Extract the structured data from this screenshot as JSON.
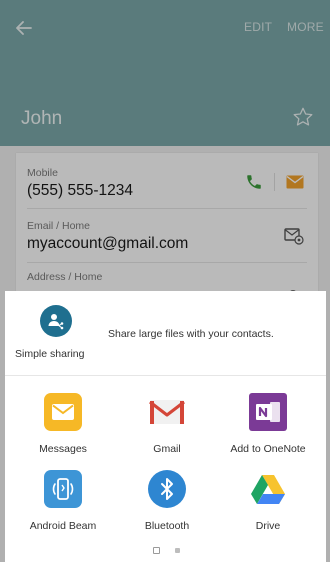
{
  "header": {
    "name": "John",
    "edit_label": "EDIT",
    "more_label": "MORE"
  },
  "contact": {
    "mobile": {
      "label": "Mobile",
      "value": "(555) 555-1234"
    },
    "email": {
      "label": "Email / Home",
      "value": "myaccount@gmail.com"
    },
    "address": {
      "label": "Address / Home"
    }
  },
  "share_sheet": {
    "simple_sharing": {
      "label": "Simple sharing",
      "description": "Share large files with your contacts."
    },
    "apps": [
      {
        "label": "Messages",
        "icon": "messages-icon"
      },
      {
        "label": "Gmail",
        "icon": "gmail-icon"
      },
      {
        "label": "Add to OneNote",
        "icon": "onenote-icon"
      },
      {
        "label": "Android Beam",
        "icon": "android-beam-icon"
      },
      {
        "label": "Bluetooth",
        "icon": "bluetooth-icon"
      },
      {
        "label": "Drive",
        "icon": "drive-icon"
      }
    ],
    "page_indicator": {
      "current": 1,
      "total": 2
    }
  },
  "colors": {
    "header": "#7aa6a8",
    "call_green": "#3c9a3c",
    "message_orange": "#f0a12c",
    "simple_sharing": "#1f6f8f",
    "messages": "#f6b826",
    "gmail_red": "#d44638",
    "onenote": "#7b3a96",
    "android_beam": "#3d95d6",
    "bluetooth": "#2e86d1"
  }
}
